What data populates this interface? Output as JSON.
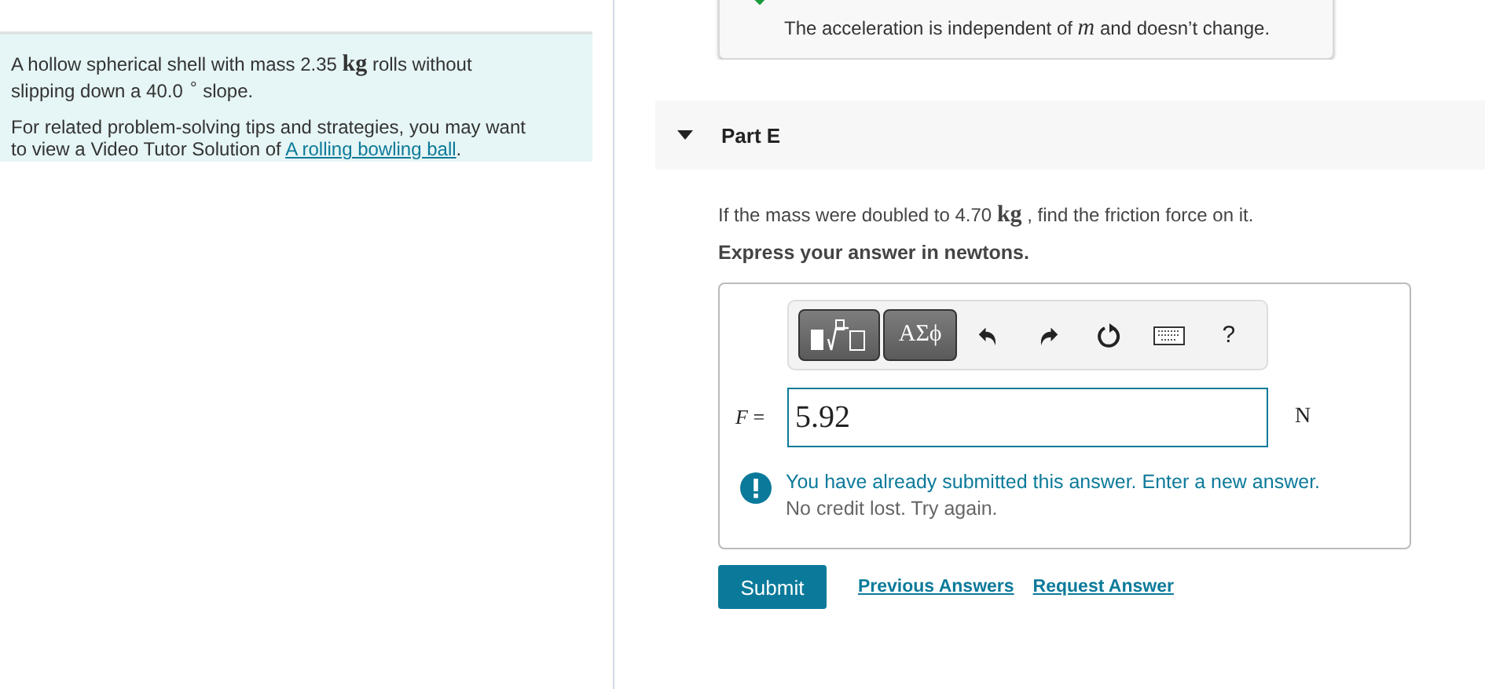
{
  "problem": {
    "statement": "A hollow spherical shell with mass 2.35 **kg** rolls without slipping down a 40.0 $^{∘}$ slope.",
    "tip_text": "For related problem-solving tips and strategies, you may want to view a Video Tutor Solution of",
    "tip_link": "A rolling bowling ball",
    "tip_end": "."
  },
  "previous_feedback": {
    "text": "The acceleration is independent of *m* and doesn’t change."
  },
  "part": {
    "title": "Part E",
    "expanded": true
  },
  "question": "If the mass were doubled to 4.70 **kg** , find the friction force on it.",
  "instruction": "Express your answer in newtons.",
  "toolbar": [
    {
      "kind": "templates"
    },
    {
      "kind": "symbols",
      "label": "ΑΣϕ"
    },
    {
      "kind": "undo"
    },
    {
      "kind": "redo"
    },
    {
      "kind": "reset"
    },
    {
      "kind": "keyboard"
    },
    {
      "kind": "help",
      "label": "?"
    }
  ],
  "answer": {
    "variable": "F",
    "equals": "=",
    "value": "5.92",
    "unit": "N"
  },
  "warning": {
    "line1": "You have already submitted this answer. Enter a new answer.",
    "line2": "No credit lost. Try again."
  },
  "buttons": {
    "submit": "Submit",
    "links": [
      "Previous Answers",
      "Request Answer"
    ]
  }
}
